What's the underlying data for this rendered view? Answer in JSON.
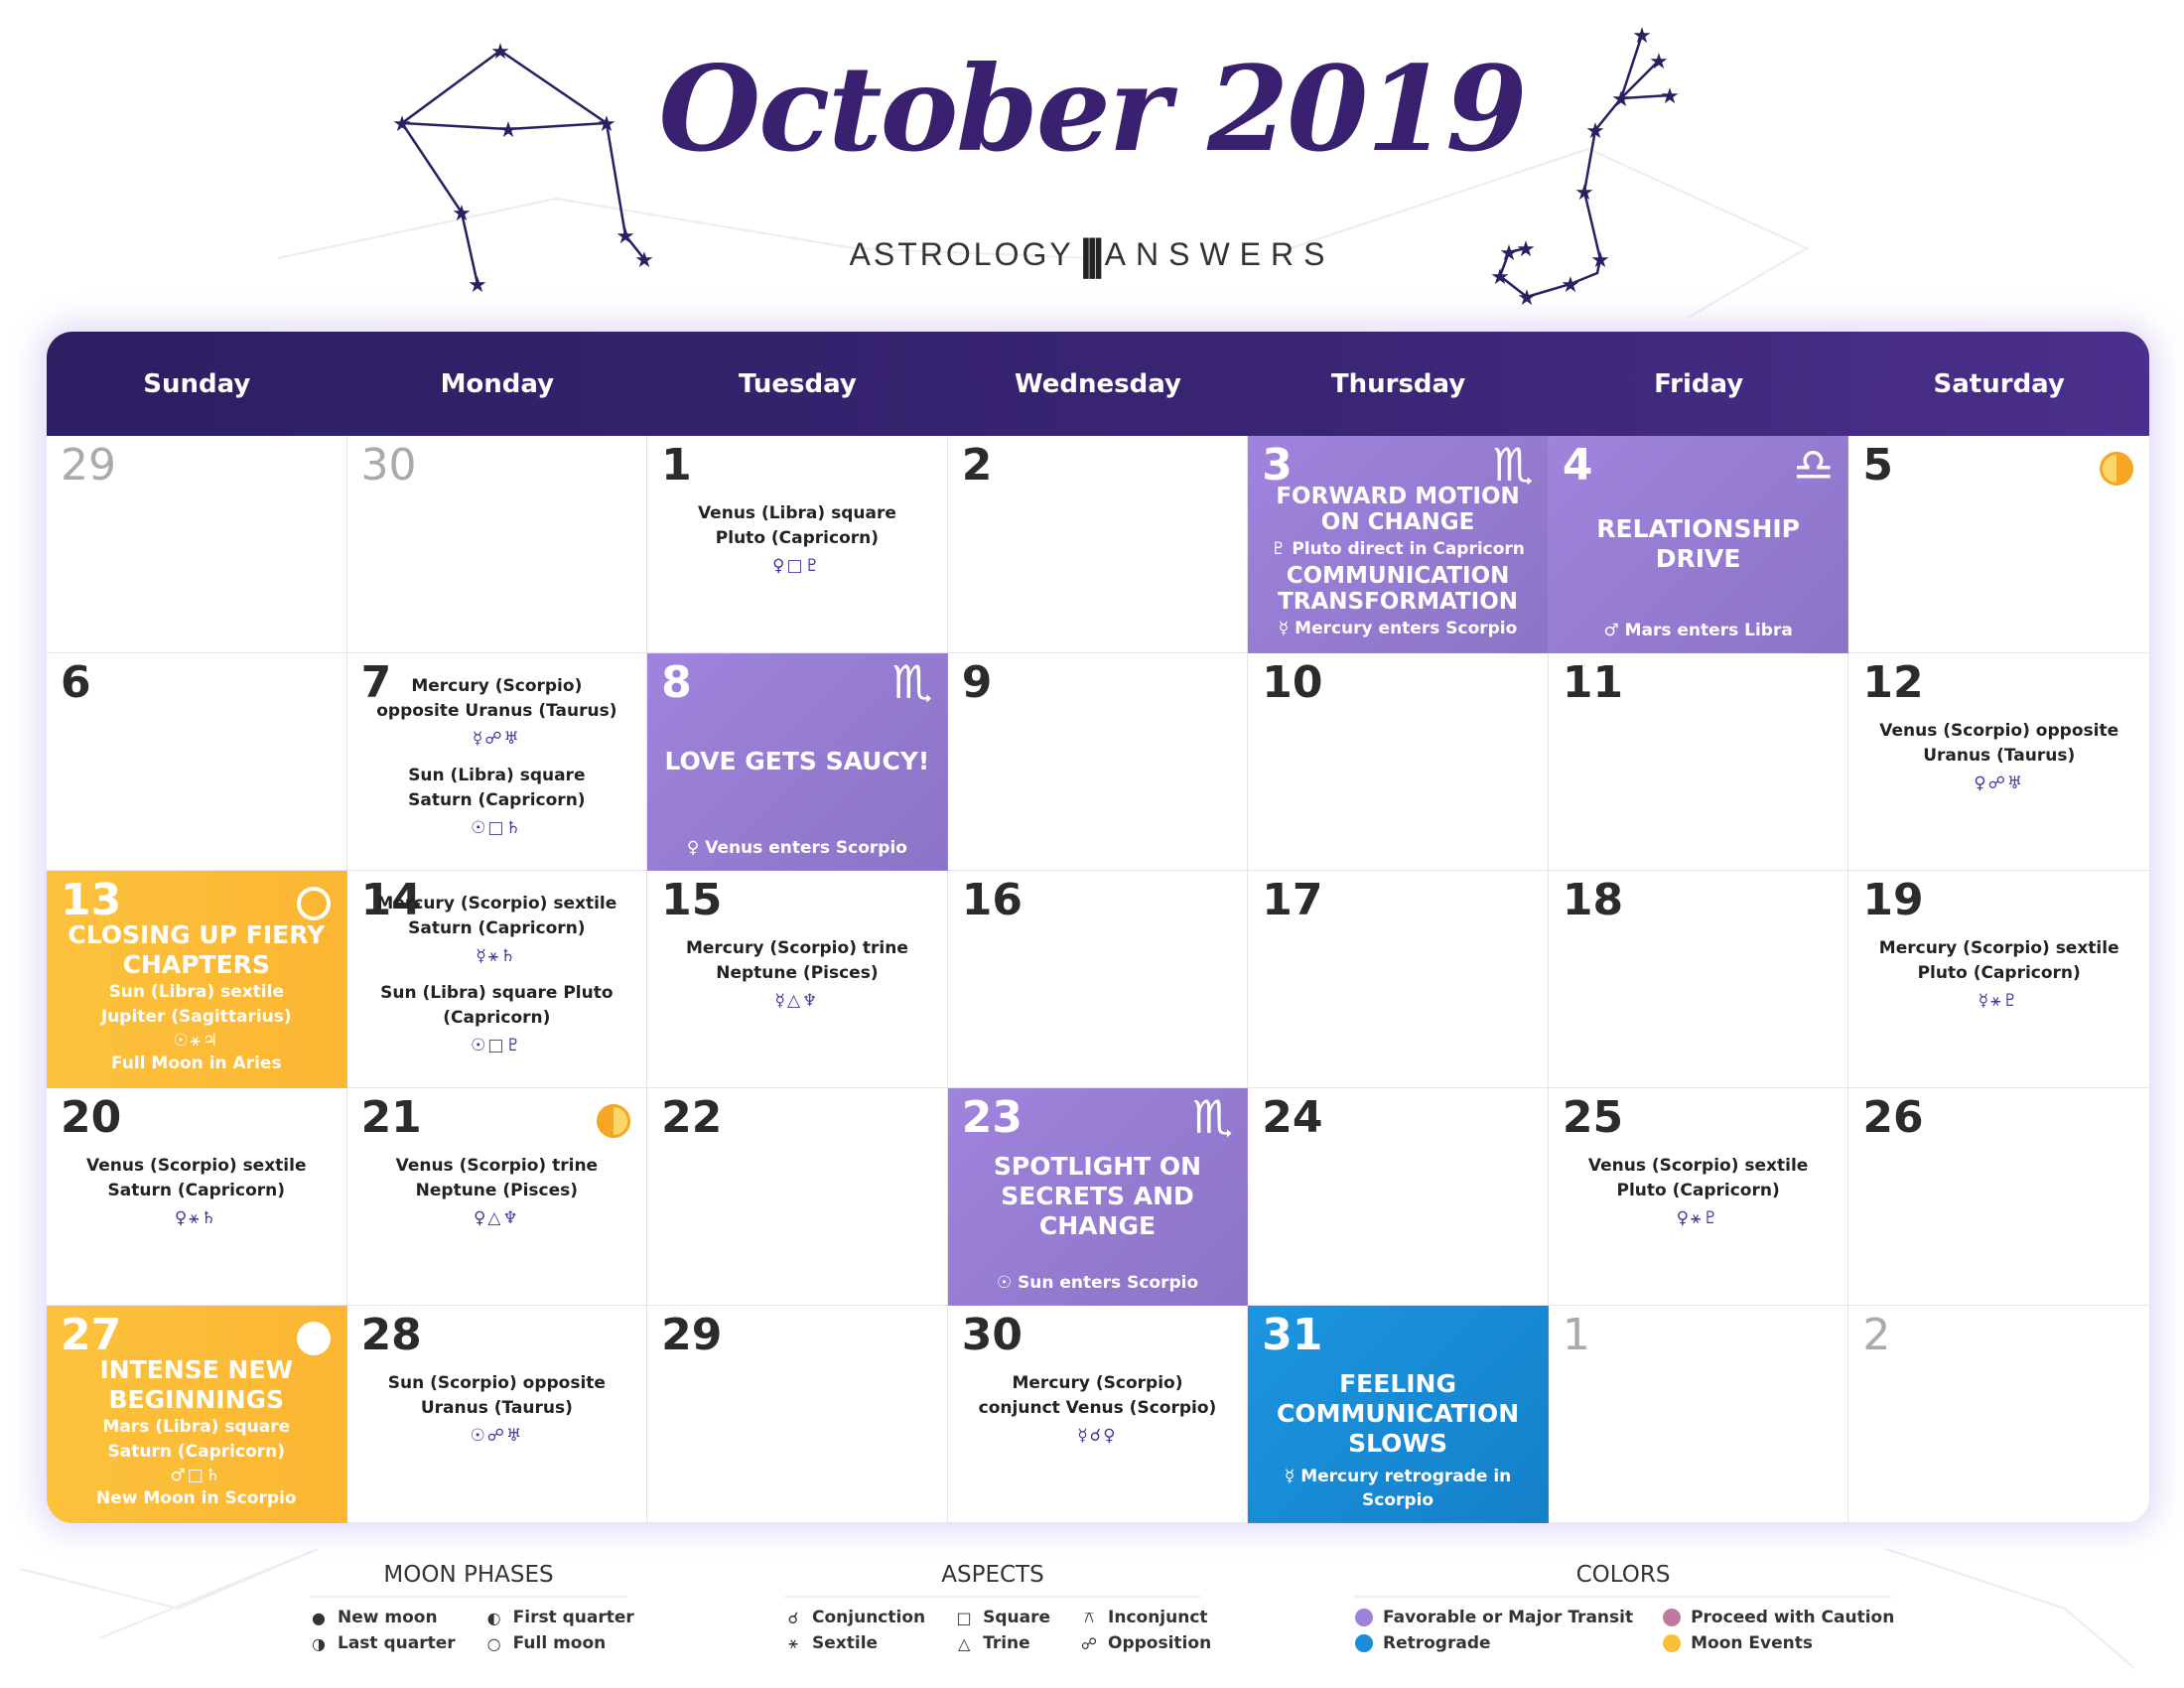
{
  "title": "October 2019",
  "logo": {
    "left": "ASTROLOGY",
    "right": "ANSWERS"
  },
  "weekdays": [
    "Sunday",
    "Monday",
    "Tuesday",
    "Wednesday",
    "Thursday",
    "Friday",
    "Saturday"
  ],
  "colors": {
    "favorable": "#9b83d9",
    "retrograde": "#1a8cd8",
    "caution": "#c07aa0",
    "moon_events": "#fbbf3a",
    "header": "#2e1f66"
  },
  "weeks": [
    {
      "days": [
        {
          "day": "29",
          "muted": true
        },
        {
          "day": "30",
          "muted": true
        },
        {
          "day": "1",
          "aspects": [
            {
              "text": "Venus (Libra) square Pluto (Capricorn)",
              "glyph": "♀□♇"
            }
          ]
        },
        {
          "day": "2"
        },
        {
          "day": "3",
          "style": "purple",
          "sign": "♏",
          "blocks": [
            {
              "head": "FORWARD MOTION ON CHANGE",
              "note": "♇ Pluto direct in Capricorn"
            },
            {
              "head": "COMMUNICATION TRANSFORMATION",
              "note": "☿ Mercury enters Scorpio"
            }
          ]
        },
        {
          "day": "4",
          "style": "purple",
          "sign": "♎",
          "blocks": [
            {
              "head": "RELATIONSHIP DRIVE",
              "note": "♂ Mars enters Libra"
            }
          ]
        },
        {
          "day": "5",
          "moon": "first"
        }
      ]
    },
    {
      "days": [
        {
          "day": "6"
        },
        {
          "day": "7",
          "aspects": [
            {
              "text": "Mercury (Scorpio) opposite Uranus (Taurus)",
              "glyph": "☿☍♅"
            },
            {
              "text": "Sun (Libra) square Saturn (Capricorn)",
              "glyph": "☉□♄"
            }
          ]
        },
        {
          "day": "8",
          "style": "purple",
          "sign": "♏",
          "blocks": [
            {
              "head": "LOVE GETS SAUCY!",
              "note": "♀ Venus enters Scorpio"
            }
          ]
        },
        {
          "day": "9"
        },
        {
          "day": "10"
        },
        {
          "day": "11"
        },
        {
          "day": "12",
          "aspects": [
            {
              "text": "Venus (Scorpio) opposite Uranus (Taurus)",
              "glyph": "♀☍♅"
            }
          ]
        }
      ]
    },
    {
      "days": [
        {
          "day": "13",
          "style": "yellow",
          "moon": "full",
          "blocks": [
            {
              "head": "CLOSING UP FIERY CHAPTERS"
            }
          ],
          "aspects": [
            {
              "text": "Sun (Libra) sextile Jupiter (Sagittarius)",
              "glyph": "☉⚹♃"
            }
          ],
          "footer": "Full Moon in Aries"
        },
        {
          "day": "14",
          "aspects": [
            {
              "text": "Mercury (Scorpio) sextile Saturn (Capricorn)",
              "glyph": "☿⚹♄"
            },
            {
              "text": "Sun (Libra) square Pluto (Capricorn)",
              "glyph": "☉□♇"
            }
          ]
        },
        {
          "day": "15",
          "aspects": [
            {
              "text": "Mercury (Scorpio) trine Neptune (Pisces)",
              "glyph": "☿△♆"
            }
          ]
        },
        {
          "day": "16"
        },
        {
          "day": "17"
        },
        {
          "day": "18"
        },
        {
          "day": "19",
          "aspects": [
            {
              "text": "Mercury (Scorpio) sextile Pluto (Capricorn)",
              "glyph": "☿⚹♇"
            }
          ]
        }
      ]
    },
    {
      "days": [
        {
          "day": "20",
          "aspects": [
            {
              "text": "Venus (Scorpio) sextile Saturn (Capricorn)",
              "glyph": "♀⚹♄"
            }
          ]
        },
        {
          "day": "21",
          "moon": "last",
          "aspects": [
            {
              "text": "Venus (Scorpio) trine Neptune (Pisces)",
              "glyph": "♀△♆"
            }
          ]
        },
        {
          "day": "22"
        },
        {
          "day": "23",
          "style": "purple",
          "sign": "♏",
          "blocks": [
            {
              "head": "SPOTLIGHT ON SECRETS AND CHANGE",
              "note": "☉ Sun enters Scorpio"
            }
          ]
        },
        {
          "day": "24"
        },
        {
          "day": "25",
          "aspects": [
            {
              "text": "Venus (Scorpio) sextile Pluto (Capricorn)",
              "glyph": "♀⚹♇"
            }
          ]
        },
        {
          "day": "26"
        }
      ]
    },
    {
      "days": [
        {
          "day": "27",
          "style": "yellow",
          "moon": "new",
          "blocks": [
            {
              "head": "INTENSE NEW BEGINNINGS"
            }
          ],
          "aspects": [
            {
              "text": "Mars (Libra) square Saturn (Capricorn)",
              "glyph": "♂□♄"
            }
          ],
          "footer": "New Moon in Scorpio"
        },
        {
          "day": "28",
          "aspects": [
            {
              "text": "Sun (Scorpio) opposite Uranus (Taurus)",
              "glyph": "☉☍♅"
            }
          ]
        },
        {
          "day": "29"
        },
        {
          "day": "30",
          "aspects": [
            {
              "text": "Mercury (Scorpio) conjunct Venus (Scorpio)",
              "glyph": "☿☌♀"
            }
          ]
        },
        {
          "day": "31",
          "style": "blue",
          "blocks": [
            {
              "head": "FEELING COMMUNICATION SLOWS",
              "note": "☿ Mercury retrograde in Scorpio"
            }
          ]
        },
        {
          "day": "1",
          "muted": true
        },
        {
          "day": "2",
          "muted": true
        }
      ]
    }
  ],
  "legend": {
    "moon_phases": {
      "title": "MOON PHASES",
      "items": [
        {
          "symbol": "●",
          "label": "New moon"
        },
        {
          "symbol": "◐",
          "label": "First quarter"
        },
        {
          "symbol": "◑",
          "label": "Last quarter"
        },
        {
          "symbol": "○",
          "label": "Full moon"
        }
      ]
    },
    "aspects": {
      "title": "ASPECTS",
      "items": [
        {
          "symbol": "☌",
          "label": "Conjunction"
        },
        {
          "symbol": "□",
          "label": "Square"
        },
        {
          "symbol": "⚻",
          "label": "Inconjunct"
        },
        {
          "symbol": "⚹",
          "label": "Sextile"
        },
        {
          "symbol": "△",
          "label": "Trine"
        },
        {
          "symbol": "☍",
          "label": "Opposition"
        }
      ]
    },
    "colors": {
      "title": "COLORS",
      "items": [
        {
          "color": "#9b83d9",
          "label": "Favorable or Major Transit"
        },
        {
          "color": "#c07aa0",
          "label": "Proceed with Caution"
        },
        {
          "color": "#1a8cd8",
          "label": "Retrograde"
        },
        {
          "color": "#fbbf3a",
          "label": "Moon Events"
        }
      ]
    }
  }
}
